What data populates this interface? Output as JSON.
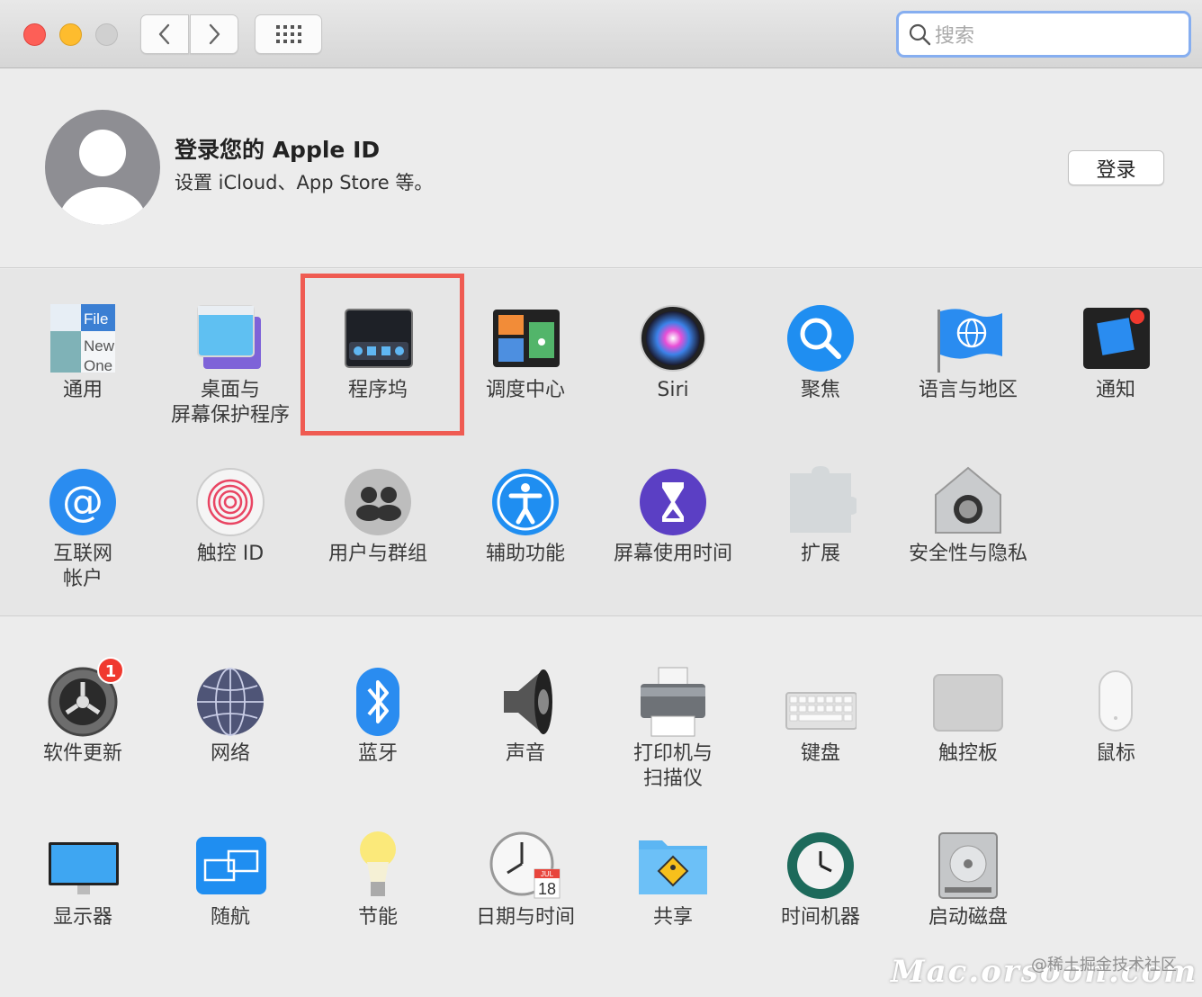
{
  "search": {
    "placeholder": "搜索"
  },
  "account": {
    "title": "登录您的 Apple ID",
    "subtitle": "设置 iCloud、App Store 等。",
    "login_label": "登录"
  },
  "row1": [
    {
      "label": "通用",
      "icon": "general-icon"
    },
    {
      "label": "桌面与\n屏幕保护程序",
      "icon": "desktop-screensaver-icon"
    },
    {
      "label": "程序坞",
      "icon": "dock-icon"
    },
    {
      "label": "调度中心",
      "icon": "mission-control-icon"
    },
    {
      "label": "Siri",
      "icon": "siri-icon"
    },
    {
      "label": "聚焦",
      "icon": "spotlight-icon"
    },
    {
      "label": "语言与地区",
      "icon": "language-region-icon"
    },
    {
      "label": "通知",
      "icon": "notifications-icon"
    }
  ],
  "row2": [
    {
      "label": "互联网\n帐户",
      "icon": "internet-accounts-icon"
    },
    {
      "label": "触控 ID",
      "icon": "touch-id-icon"
    },
    {
      "label": "用户与群组",
      "icon": "users-groups-icon"
    },
    {
      "label": "辅助功能",
      "icon": "accessibility-icon"
    },
    {
      "label": "屏幕使用时间",
      "icon": "screen-time-icon"
    },
    {
      "label": "扩展",
      "icon": "extensions-icon"
    },
    {
      "label": "安全性与隐私",
      "icon": "security-privacy-icon"
    }
  ],
  "row3": [
    {
      "label": "软件更新",
      "icon": "software-update-icon",
      "badge": "1"
    },
    {
      "label": "网络",
      "icon": "network-icon"
    },
    {
      "label": "蓝牙",
      "icon": "bluetooth-icon"
    },
    {
      "label": "声音",
      "icon": "sound-icon"
    },
    {
      "label": "打印机与\n扫描仪",
      "icon": "printers-scanners-icon"
    },
    {
      "label": "键盘",
      "icon": "keyboard-icon"
    },
    {
      "label": "触控板",
      "icon": "trackpad-icon"
    },
    {
      "label": "鼠标",
      "icon": "mouse-icon"
    }
  ],
  "row4": [
    {
      "label": "显示器",
      "icon": "displays-icon"
    },
    {
      "label": "随航",
      "icon": "sidecar-icon"
    },
    {
      "label": "节能",
      "icon": "energy-saver-icon"
    },
    {
      "label": "日期与时间",
      "icon": "date-time-icon"
    },
    {
      "label": "共享",
      "icon": "sharing-icon"
    },
    {
      "label": "时间机器",
      "icon": "time-machine-icon"
    },
    {
      "label": "启动磁盘",
      "icon": "startup-disk-icon"
    }
  ],
  "icon_text": {
    "general": [
      "File",
      "New",
      "One"
    ],
    "date_month": "JUL",
    "date_day": "18"
  },
  "watermark": {
    "site": "@稀土掘金技术社区",
    "brand": "Mac.orsoon.com"
  },
  "colors": {
    "highlight": "#ef5b52",
    "badge": "#f0392f",
    "accent": "#86aef0"
  }
}
